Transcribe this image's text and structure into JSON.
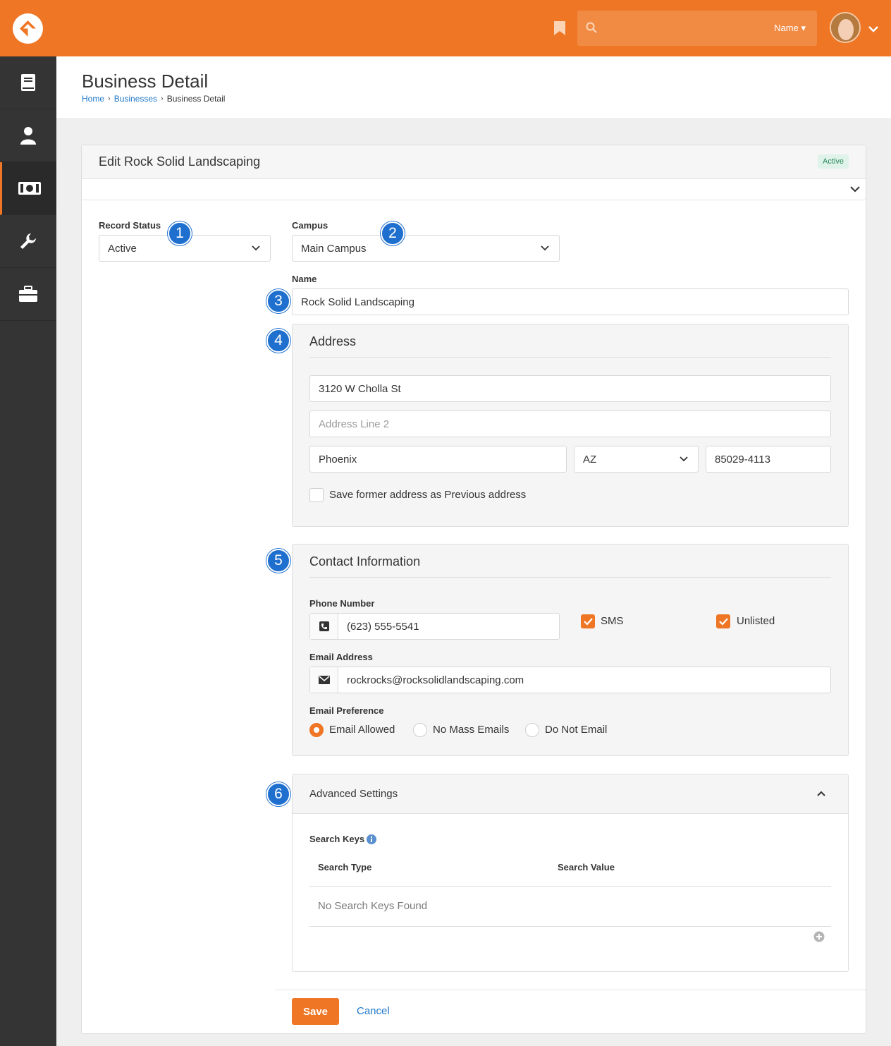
{
  "header": {
    "search_scope": "Name",
    "search_placeholder": ""
  },
  "page": {
    "title": "Business Detail",
    "breadcrumb": [
      "Home",
      "Businesses",
      "Business Detail"
    ]
  },
  "panel": {
    "title": "Edit Rock Solid Landscaping",
    "status_badge": "Active"
  },
  "form": {
    "record_status": {
      "label": "Record Status",
      "value": "Active"
    },
    "campus": {
      "label": "Campus",
      "value": "Main Campus"
    },
    "name": {
      "label": "Name",
      "value": "Rock Solid Landscaping"
    }
  },
  "address": {
    "title": "Address",
    "street1": "3120 W Cholla St",
    "street2_placeholder": "Address Line 2",
    "city": "Phoenix",
    "state": "AZ",
    "zip": "85029-4113",
    "save_former_label": "Save former address as Previous address",
    "save_former_checked": false
  },
  "contact": {
    "title": "Contact Information",
    "phone_label": "Phone Number",
    "phone_value": "(623) 555-5541",
    "sms_label": "SMS",
    "sms_checked": true,
    "unlisted_label": "Unlisted",
    "unlisted_checked": true,
    "email_label": "Email Address",
    "email_value": "rockrocks@rocksolidlandscaping.com",
    "email_pref_label": "Email Preference",
    "email_pref_options": [
      "Email Allowed",
      "No Mass Emails",
      "Do Not Email"
    ],
    "email_pref_selected": "Email Allowed"
  },
  "advanced": {
    "title": "Advanced Settings",
    "search_keys_label": "Search Keys",
    "columns": [
      "Search Type",
      "Search Value"
    ],
    "empty_text": "No Search Keys Found"
  },
  "callouts": [
    "1",
    "2",
    "3",
    "4",
    "5",
    "6"
  ],
  "actions": {
    "save_label": "Save",
    "cancel_label": "Cancel"
  },
  "colors": {
    "brand": "#ee7625",
    "sidebar": "#343434",
    "link": "#2078c8",
    "callout": "#1f6fcf"
  },
  "icons": [
    "rock-logo-icon",
    "bookmark-icon",
    "search-icon",
    "chevron-down-icon",
    "book-icon",
    "person-icon",
    "money-icon",
    "wrench-icon",
    "briefcase-icon",
    "phone-icon",
    "envelope-icon",
    "info-icon",
    "chevron-up-icon",
    "add-circle-icon"
  ]
}
